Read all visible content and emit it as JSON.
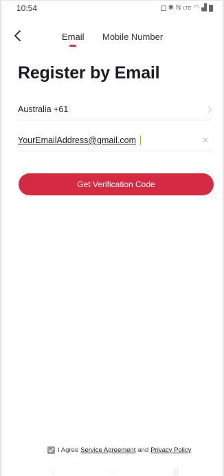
{
  "status_bar": {
    "time": "10:54",
    "icons": [
      "alarm-icon",
      "bluetooth-icon",
      "nfc-icon",
      "lte-icon",
      "wifi-icon",
      "signal-icon",
      "battery-icon"
    ]
  },
  "nav": {
    "back_icon": "chevron-left-icon",
    "tabs": [
      {
        "label": "Email",
        "selected": true
      },
      {
        "label": "Mobile Number",
        "selected": false
      }
    ]
  },
  "title": "Register by Email",
  "country": {
    "label": "Australia +61",
    "icon": "chevron-right-icon"
  },
  "email": {
    "value": "YourEmailAddress@gmail.com",
    "clear_icon": "clear-icon"
  },
  "cta": {
    "label": "Get Verification Code"
  },
  "agreement": {
    "prefix": "I Agree",
    "service_link": "Service Agreement",
    "conjunction": "and",
    "privacy_link": "Privacy Policy",
    "checked": true
  },
  "colors": {
    "accent": "#d52a41",
    "text": "#1f1f1f"
  }
}
